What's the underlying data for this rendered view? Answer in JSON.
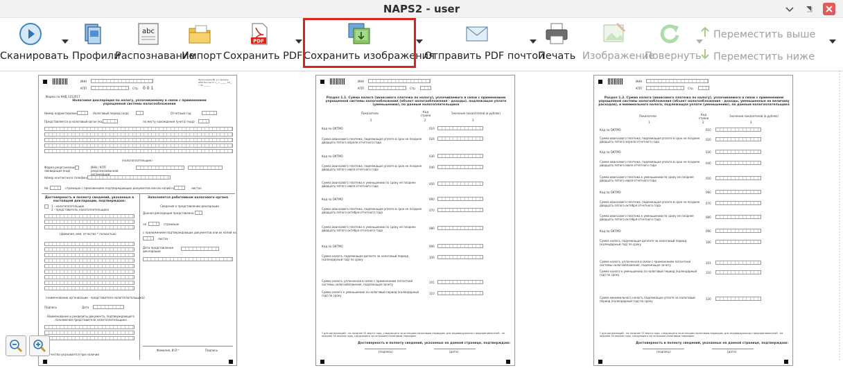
{
  "window": {
    "title": "NAPS2 - user"
  },
  "toolbar": {
    "scan": {
      "label": "Сканировать",
      "icon": "scan-icon"
    },
    "profiles": {
      "label": "Профили",
      "icon": "profiles-icon"
    },
    "ocr": {
      "label": "Распознавание",
      "icon": "ocr-icon"
    },
    "import": {
      "label": "Импорт",
      "icon": "import-icon"
    },
    "save_pdf": {
      "label": "Сохранить PDF",
      "icon": "pdf-icon"
    },
    "save_images": {
      "label": "Сохранить изображения",
      "icon": "save-images-icon"
    },
    "email_pdf": {
      "label": "Отправить PDF почтой",
      "icon": "email-icon"
    },
    "print": {
      "label": "Печать",
      "icon": "printer-icon"
    },
    "image": {
      "label": "Изображение",
      "icon": "image-icon"
    },
    "rotate": {
      "label": "Повернуть",
      "icon": "rotate-icon"
    },
    "move_up": {
      "label": "Переместить выше",
      "icon": "arrow-up-icon"
    },
    "move_down": {
      "label": "Переместить ниже",
      "icon": "arrow-down-icon"
    }
  },
  "pages": {
    "p1": {
      "inn": "ИНН",
      "kpp": "КПП",
      "str": "Стр.",
      "page_no": "0 0 1",
      "form_code": "Форма по КНД 1152017",
      "heading": "Налоговая декларация по налогу, уплачиваемому в связи с применением упрощенной системы налогообложения",
      "correction": "Номер корректировки",
      "tax_period": "Налоговый период (код)",
      "report_year": "Отчетный год",
      "submitted": "Представляется в налоговый орган (код)",
      "location": "по месту нахождения (учета) (код)",
      "taxpayer": "(налогоплательщик)",
      "reorg_form": "Форма реорганизации, ликвидация (код)",
      "inn_kpp_reorg": "ИНН / КПП реорганизованной организации",
      "phone": "Номер контактного телефона",
      "pages_on": "На",
      "pages_text": "страницах с приложением подтверждающих документов или их копий на",
      "sheets": "листах",
      "confirm_title": "Достоверность и полноту сведений, указанных в настоящей декларации, подтверждаю:",
      "confirm_1": "1 - налогоплательщик",
      "confirm_2": "2 - представитель налогоплательщика",
      "fio": "(фамилия, имя, отчество * полностью)",
      "org_name": "(наименование организации - представителя налогоплательщика)",
      "sign": "Подпись",
      "date": "Дата",
      "doc_name": "Наименование и реквизиты документа, подтверждающего полномочия представителя налогоплательщика",
      "footnote": "* Отчество указывается при наличии",
      "official_title": "Заполняется работником налогового органа",
      "official_sub": "Сведения о представлении декларации",
      "delivery": "Данная декларация представлена (код)",
      "on_pages": "на",
      "pages_word": "страницах",
      "with_docs": "с приложением подтверждающих документов или их копий на",
      "sheets_word": "листах",
      "reg_date": "Дата представления декларации",
      "fio_short": "Фамилия, И.О.*",
      "signature": "Подпись",
      "appendix": "Приложение № 1 к приказу ФНС России от «__» ______ 20__ г. № ______"
    },
    "p2": {
      "inn": "ИНН",
      "kpp": "КПП",
      "str": "Стр.",
      "heading": "Раздел 1.1. Сумма налога (авансового платежа по налогу), уплачиваемого в связи с применением упрощенной системы налогообложения (объект налогообложения - доходы), подлежащая уплате (уменьшению), по данным налогоплательщика",
      "col1": "Показатели",
      "col2": "Код строки",
      "col3": "Значения показателей (в рублях)",
      "col_n1": "1",
      "col_n2": "2",
      "col_n3": "3",
      "rows": [
        {
          "label": "Код по ОКТМО",
          "code": "010"
        },
        {
          "label": "Сумма авансового платежа, подлежащая уплате в срок не позднее двадцать пятого апреля отчетного года",
          "code": "020"
        },
        {
          "label": "Код по ОКТМО",
          "code": "030"
        },
        {
          "label": "Сумма авансового платежа, подлежащая уплате в срок не позднее двадцать пятого июля отчетного года",
          "code": "040"
        },
        {
          "label": "Сумма авансового платежа к уменьшению по сроку не позднее двадцать пятого июля отчетного года",
          "code": "050"
        },
        {
          "label": "Код по ОКТМО",
          "code": "060"
        },
        {
          "label": "Сумма авансового платежа, подлежащая уплате в срок не позднее двадцать пятого октября отчетного года",
          "code": "070"
        },
        {
          "label": "Сумма авансового платежа к уменьшению по сроку не позднее двадцать пятого октября отчетного года",
          "code": "080"
        },
        {
          "label": "Код по ОКТМО",
          "code": "090"
        },
        {
          "label": "Сумма налога, подлежащая доплате за налоговый период (календарный год) по сроку",
          "code": "100"
        },
        {
          "label": "Сумма налога, уплаченная в связи с применением патентной системы налогообложения, подлежащая зачету",
          "code": "101"
        },
        {
          "label": "Сумма налога к уменьшению за налоговый период (календарный год) по сроку",
          "code": "110"
        }
      ],
      "footnote": "* для организаций - не позднее 31 марта года, следующего за истекшим налоговым периодом; для индивидуальных предпринимателей - не позднее 30 апреля года, следующего за истекшим налоговым периодом.",
      "confirm": "Достоверность и полноту сведений, указанных на данной странице, подтверждаю:",
      "sign": "(подпись)",
      "date": "(дата)"
    },
    "p3": {
      "inn": "ИНН",
      "kpp": "КПП",
      "str": "Стр.",
      "heading": "Раздел 1.2. Сумма налога (авансового платежа по налогу), уплачиваемого в связи с применением упрощенной системы налогообложения (объект налогообложения - доходы, уменьшенные на величину расходов), и минимального налога, подлежащая уплате (уменьшению), по данным налогоплательщика",
      "col1": "Показатели",
      "col2": "Код строки",
      "col3": "Значения показателей (в рублях)",
      "col_n1": "1",
      "col_n2": "2",
      "col_n3": "3",
      "rows": [
        {
          "label": "Код по ОКТМО",
          "code": "010"
        },
        {
          "label": "Сумма авансового платежа, подлежащая уплате в срок не позднее двадцать пятого апреля отчетного года",
          "code": "020"
        },
        {
          "label": "Код по ОКТМО",
          "code": "030"
        },
        {
          "label": "Сумма авансового платежа, подлежащая уплате в срок не позднее двадцать пятого июля отчетного года",
          "code": "040"
        },
        {
          "label": "Сумма авансового платежа к уменьшению по сроку не позднее двадцать пятого июля отчетного года",
          "code": "050"
        },
        {
          "label": "Код по ОКТМО",
          "code": "060"
        },
        {
          "label": "Сумма авансового платежа, подлежащая уплате в срок не позднее двадцать пятого октября отчетного года",
          "code": "070"
        },
        {
          "label": "Сумма авансового платежа к уменьшению по сроку не позднее двадцать пятого октября отчетного года",
          "code": "080"
        },
        {
          "label": "Код по ОКТМО",
          "code": "090"
        },
        {
          "label": "Сумма налога, подлежащая доплате за налоговый период (календарный год) по сроку",
          "code": "100"
        },
        {
          "label": "Сумма налога, уплаченная в связи с применением патентной системы налогообложения, подлежащая зачету",
          "code": "101"
        },
        {
          "label": "Сумма налога к уменьшению за налоговый период (календарный год) по сроку",
          "code": "110"
        },
        {
          "label": "Сумма минимального налога, подлежащая уплате за налоговый период (календарный год) по сроку",
          "code": "120"
        }
      ],
      "footnote": "* для организаций - не позднее 31 марта года, следующего за истекшим налоговым периодом; для индивидуальных предпринимателей - не позднее 30 апреля года, следующего за истекшим налоговым периодом.",
      "confirm": "Достоверность и полноту сведений, указанных на данной странице, подтверждаю:",
      "sign": "(подпись)",
      "date": "(дата)"
    }
  },
  "zoom": {
    "out_icon": "zoom-out-icon",
    "in_icon": "zoom-in-icon"
  },
  "colors": {
    "highlight": "#e0201c",
    "close": "#e25a5a",
    "disabled_text": "#a0a0a0"
  }
}
